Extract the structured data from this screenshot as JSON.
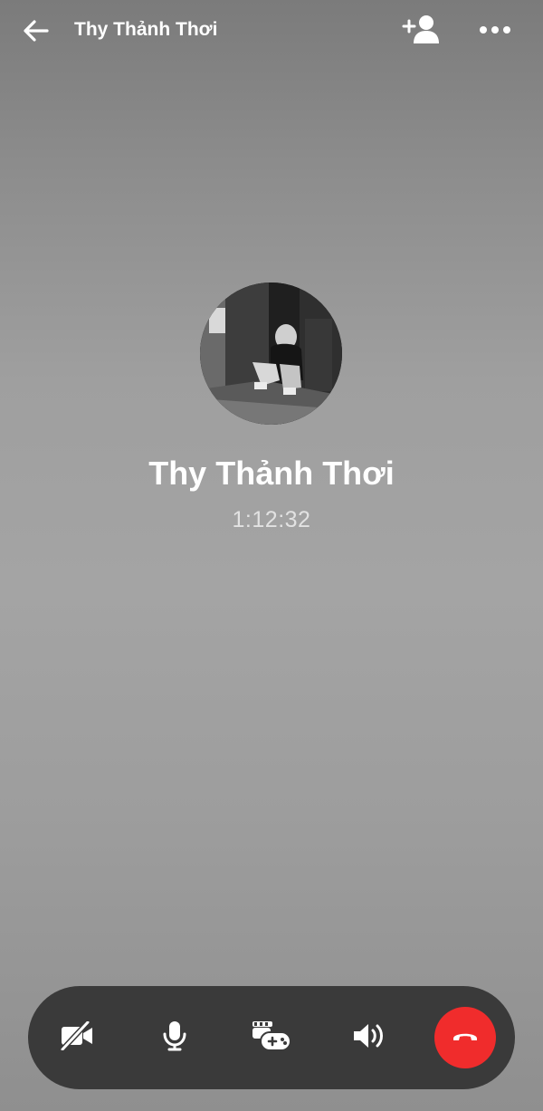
{
  "header": {
    "title": "Thy Thảnh Thơi",
    "back_icon": "arrow-left-icon",
    "add_person_icon": "add-person-icon",
    "more_icon": "more-horizontal-icon"
  },
  "call": {
    "contact_name": "Thy Thảnh Thơi",
    "duration": "1:12:32",
    "avatar_icon": "contact-photo"
  },
  "controls": {
    "items": [
      {
        "name": "camera-off",
        "icon": "video-off-icon"
      },
      {
        "name": "microphone",
        "icon": "microphone-icon"
      },
      {
        "name": "games",
        "icon": "gamepad-icon"
      },
      {
        "name": "speaker",
        "icon": "speaker-icon"
      },
      {
        "name": "end-call",
        "icon": "phone-hangup-icon"
      }
    ],
    "bar_color": "#3a3a3a",
    "end_call_color": "#f02c2c"
  }
}
